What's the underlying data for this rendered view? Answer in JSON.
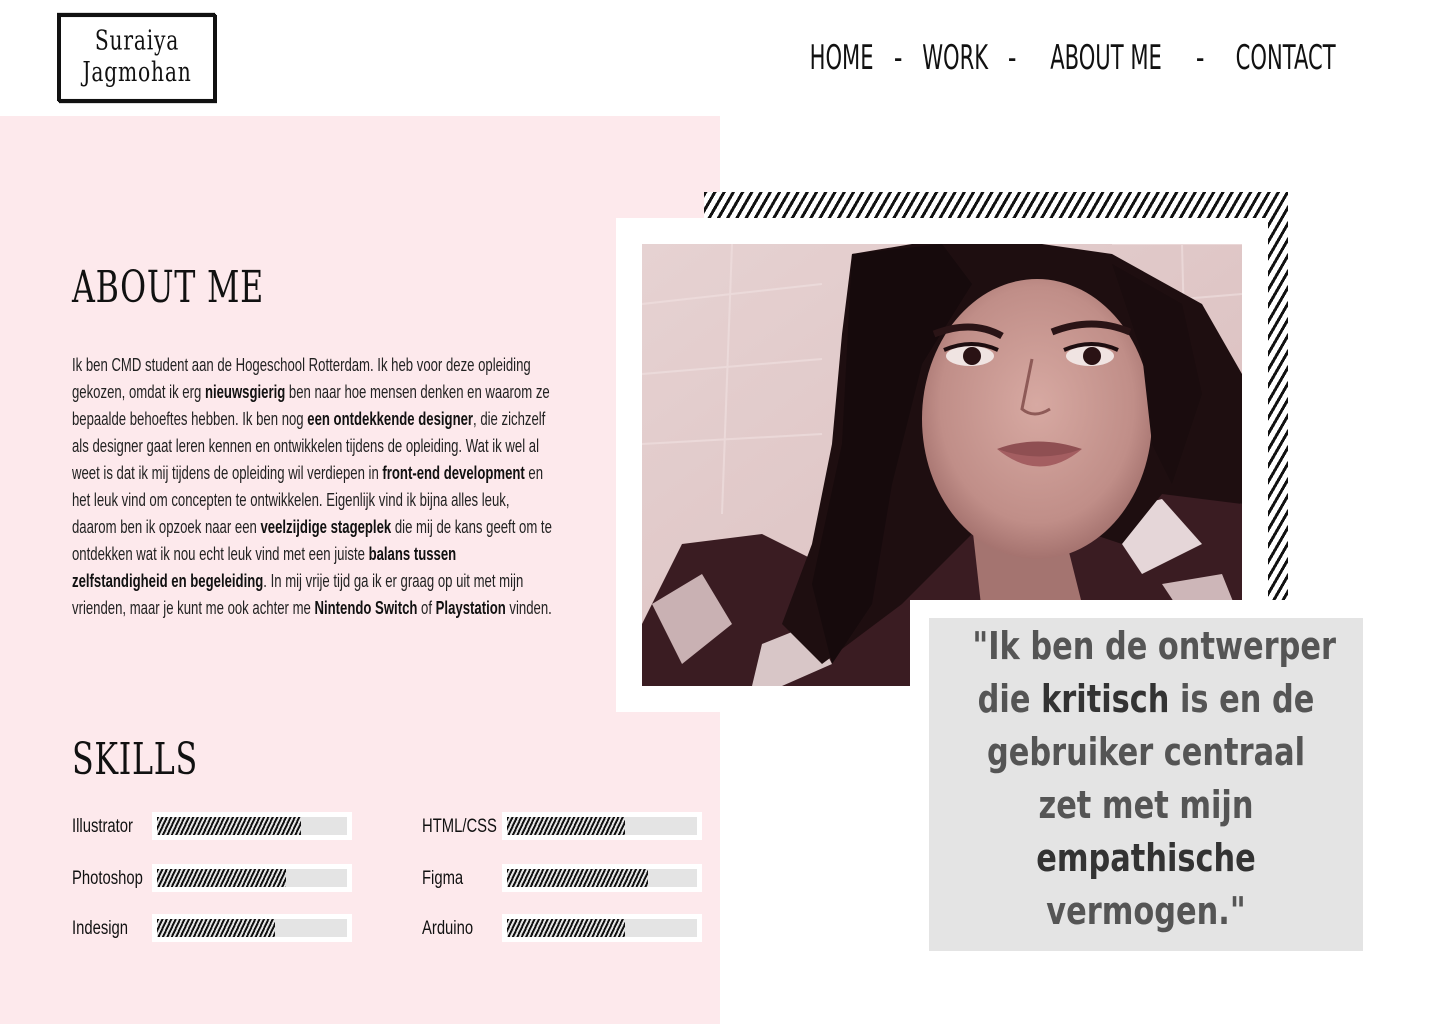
{
  "logo": {
    "line1": "Suraiya",
    "line2": "Jagmohan"
  },
  "nav": {
    "items": [
      "HOME",
      "WORK",
      "ABOUT ME",
      "CONTACT"
    ],
    "separator": "-"
  },
  "about": {
    "title": "ABOUT ME",
    "segments": [
      {
        "text": "Ik ben CMD student aan de Hogeschool Rotterdam. Ik heb voor deze opleiding gekozen, omdat ik erg ",
        "bold": false
      },
      {
        "text": "nieuwsgierig",
        "bold": true
      },
      {
        "text": " ben naar hoe mensen denken en waarom ze bepaalde behoeftes hebben. Ik ben nog ",
        "bold": false
      },
      {
        "text": "een ontdekkende designer",
        "bold": true
      },
      {
        "text": ", die zichzelf als designer gaat leren kennen en ontwikkelen tijdens de opleiding. Wat ik wel al weet is dat ik mij tijdens de opleiding wil verdiepen in ",
        "bold": false
      },
      {
        "text": "front-end development",
        "bold": true
      },
      {
        "text": " en het leuk vind om concepten te ontwikkelen. Eigenlijk vind ik bijna alles leuk, daarom ben ik opzoek naar een ",
        "bold": false
      },
      {
        "text": "veelzijdige stageplek",
        "bold": true
      },
      {
        "text": " die mij de kans geeft om te ontdekken wat ik nou echt leuk vind met een juiste ",
        "bold": false
      },
      {
        "text": "balans tussen zelfstandigheid en begeleiding",
        "bold": true
      },
      {
        "text": ". In mij vrije tijd ga ik er graag op uit met mijn vrienden, maar je kunt me ook achter me ",
        "bold": false
      },
      {
        "text": "Nintendo Switch",
        "bold": true
      },
      {
        "text": " of ",
        "bold": false
      },
      {
        "text": "Playstation",
        "bold": true
      },
      {
        "text": " vinden.",
        "bold": false
      }
    ]
  },
  "skills": {
    "title": "SKILLS",
    "items": [
      {
        "label": "Illustrator",
        "level": 0.76
      },
      {
        "label": "Photoshop",
        "level": 0.68
      },
      {
        "label": "Indesign",
        "level": 0.62
      },
      {
        "label": "HTML/CSS",
        "level": 0.62
      },
      {
        "label": "Figma",
        "level": 0.74
      },
      {
        "label": "Arduino",
        "level": 0.62
      }
    ]
  },
  "photo": {
    "icon": "portrait-photo"
  },
  "quote": {
    "lines": [
      [
        {
          "text": "\"Ik ben de ontwerper",
          "strong": false
        }
      ],
      [
        {
          "text": "die ",
          "strong": false
        },
        {
          "text": "kritisch",
          "strong": true
        },
        {
          "text": " is en de",
          "strong": false
        }
      ],
      [
        {
          "text": "gebruiker centraal",
          "strong": false
        }
      ],
      [
        {
          "text": "zet met mijn",
          "strong": false
        }
      ],
      [
        {
          "text": "empathische",
          "strong": true
        }
      ],
      [
        {
          "text": "vermogen.\"",
          "strong": false
        }
      ]
    ]
  },
  "colors": {
    "pink_panel": "#fde9ec",
    "quote_bg": "#e4e4e4",
    "text": "#111111"
  }
}
